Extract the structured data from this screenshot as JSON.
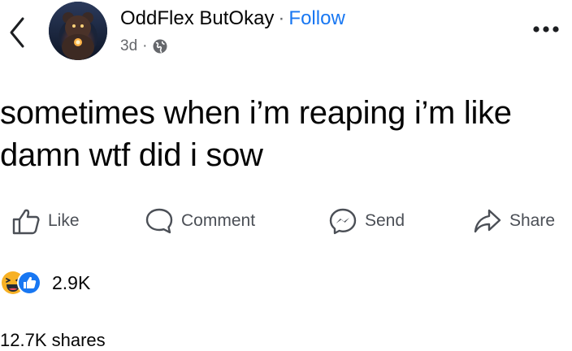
{
  "header": {
    "author_name": "OddFlex ButOkay",
    "separator": "·",
    "follow_label": "Follow",
    "timestamp": "3d",
    "meta_separator": "·",
    "audience_icon": "globe-icon",
    "back_icon": "chevron-left-icon",
    "more_icon": "more-horizontal-icon"
  },
  "post": {
    "text": "sometimes when i’m reaping i’m like damn wtf did i sow"
  },
  "actions": {
    "like": {
      "label": "Like",
      "icon": "thumbs-up-icon"
    },
    "comment": {
      "label": "Comment",
      "icon": "comment-bubble-icon"
    },
    "send": {
      "label": "Send",
      "icon": "messenger-icon"
    },
    "share": {
      "label": "Share",
      "icon": "share-arrow-icon"
    }
  },
  "stats": {
    "reactions_count": "2.9K",
    "reaction_types": [
      "haha-emoji",
      "like-emoji"
    ],
    "shares_text": "12.7K shares"
  },
  "colors": {
    "text": "#050505",
    "secondary": "#65676b",
    "link": "#1877f2",
    "like_blue": "#1877f2",
    "haha_yellow": "#f7b125"
  }
}
